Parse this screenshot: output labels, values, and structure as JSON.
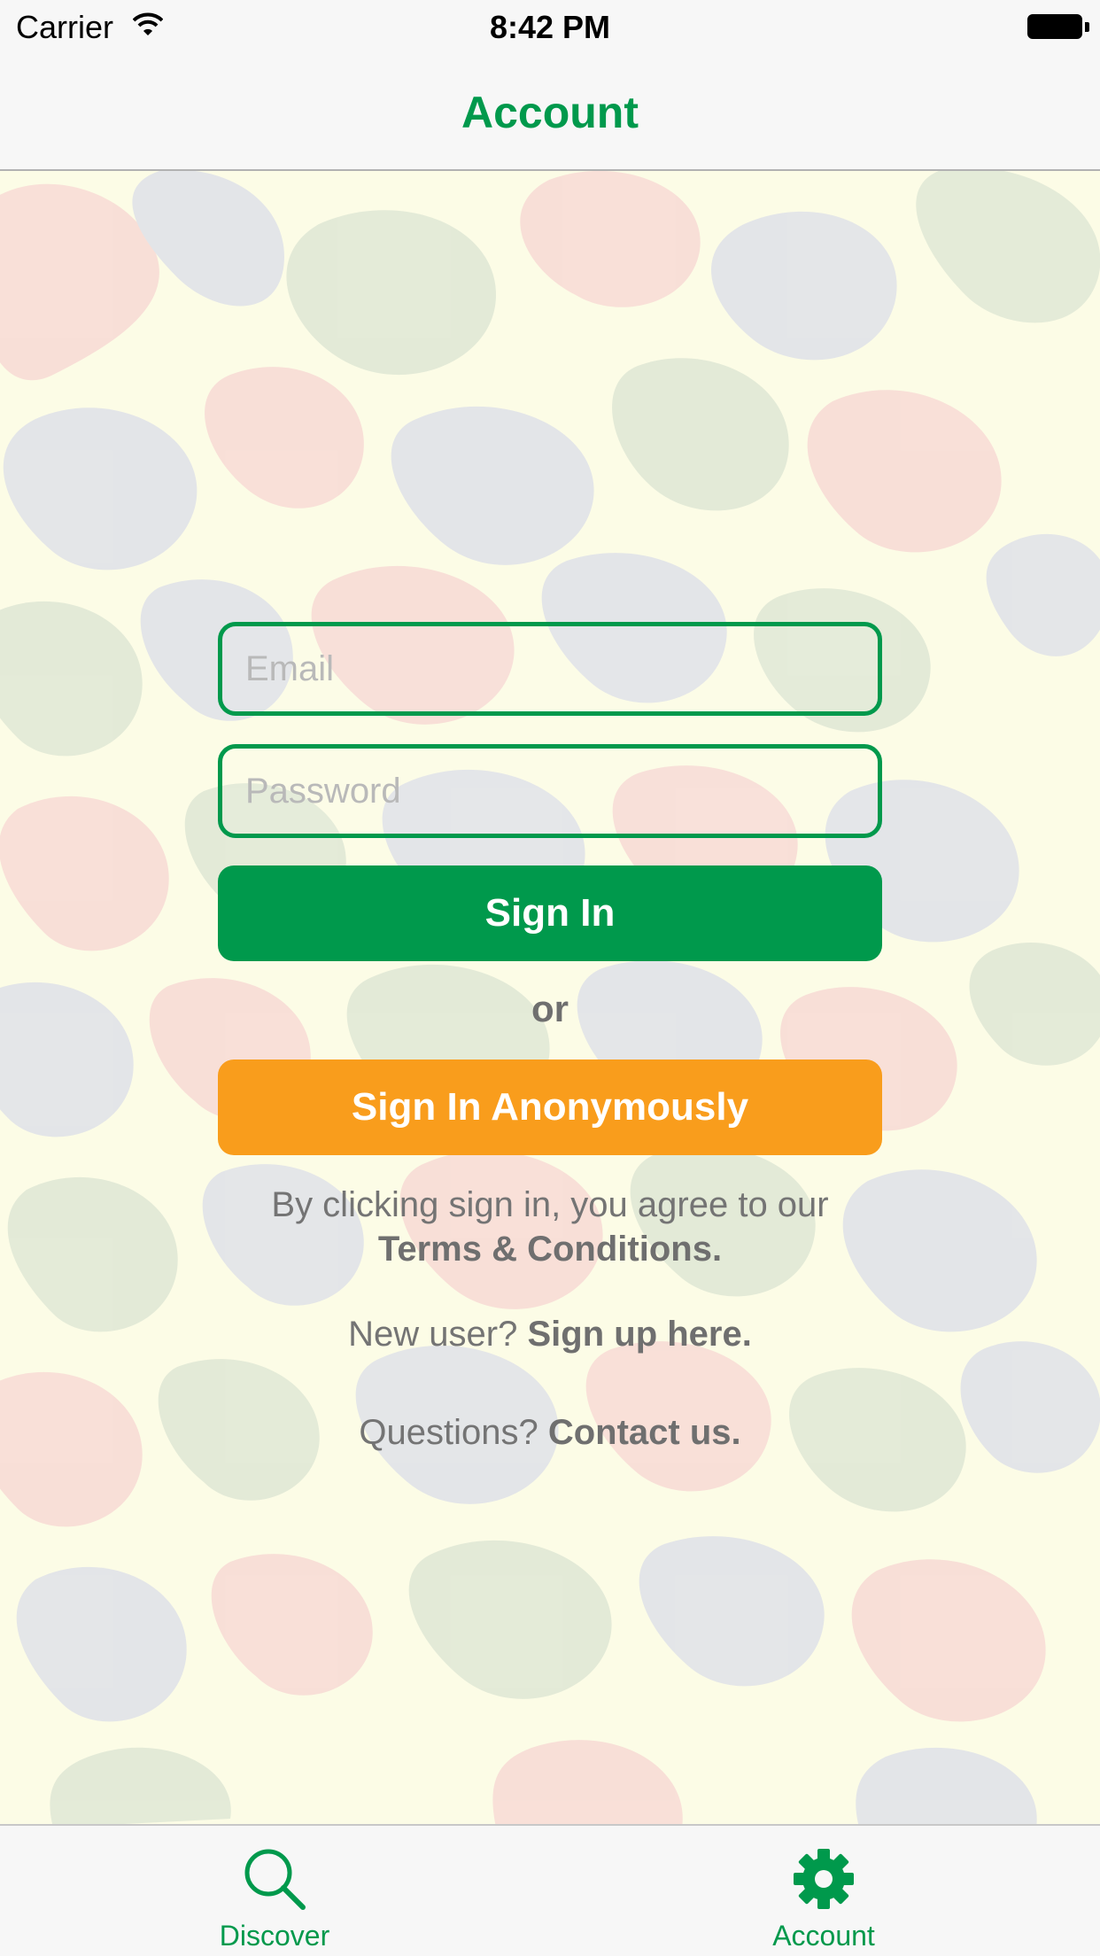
{
  "status_bar": {
    "carrier": "Carrier",
    "time": "8:42 PM"
  },
  "nav": {
    "title": "Account"
  },
  "form": {
    "email_placeholder": "Email",
    "password_placeholder": "Password",
    "sign_in_label": "Sign In",
    "or_label": "or",
    "anon_label": "Sign In Anonymously"
  },
  "terms": {
    "prefix": "By clicking sign in, you agree to our",
    "link": "Terms & Conditions."
  },
  "signup": {
    "prefix": "New user?",
    "link": "Sign up here."
  },
  "contact": {
    "prefix": "Questions?",
    "link": "Contact us."
  },
  "tabs": [
    {
      "label": "Discover",
      "icon": "search-icon"
    },
    {
      "label": "Account",
      "icon": "gear-icon",
      "active": true
    }
  ],
  "colors": {
    "brand_green": "#00994c",
    "accent_orange": "#f99d1c",
    "text_gray": "#747474"
  }
}
